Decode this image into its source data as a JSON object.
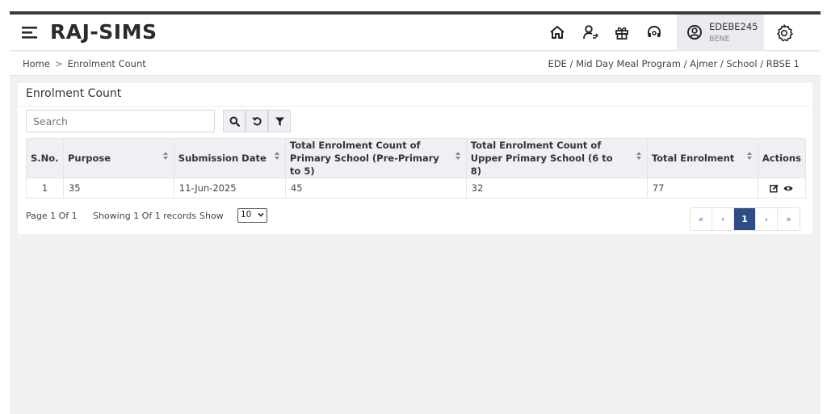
{
  "app": {
    "title": "RAJ-SIMS",
    "user_id": "EDEBE245",
    "user_role": "BENE"
  },
  "icons": {
    "menu": "menu-icon",
    "home": "home-icon",
    "user_switch": "user-switch-icon",
    "gift": "gift-icon",
    "support": "headset-icon",
    "profile": "user-circle-icon",
    "settings": "gear-icon"
  },
  "breadcrumb": {
    "home": "Home",
    "separator": ">",
    "current": "Enrolment Count",
    "context_path": "EDE / Mid Day Meal Program / Ajmer / School / RBSE 1"
  },
  "card": {
    "title": "Enrolment Count",
    "search_placeholder": "Search"
  },
  "table": {
    "headers": {
      "sno": "S.No.",
      "purpose": "Purpose",
      "submission_date": "Submission Date",
      "primary": "Total Enrolment Count of Primary School (Pre-Primary to 5)",
      "upper": "Total Enrolment Count of Upper Primary School (6 to 8)",
      "total": "Total Enrolment",
      "actions": "Actions"
    },
    "rows": [
      {
        "sno": "1",
        "purpose": "35",
        "submission_date": "11-Jun-2025",
        "primary": "45",
        "upper": "32",
        "total": "77"
      }
    ]
  },
  "footer": {
    "page_info": "Page 1 Of 1",
    "records_info": "Showing 1 Of 1 records",
    "show_label": "Show",
    "page_size": "10"
  },
  "pagination": {
    "first": "«",
    "prev": "‹",
    "current": "1",
    "next": "›",
    "last": "»"
  },
  "colors": {
    "accent": "#2e4d87",
    "header_bg": "#eef0f3",
    "page_bg": "#f1f1f1"
  }
}
